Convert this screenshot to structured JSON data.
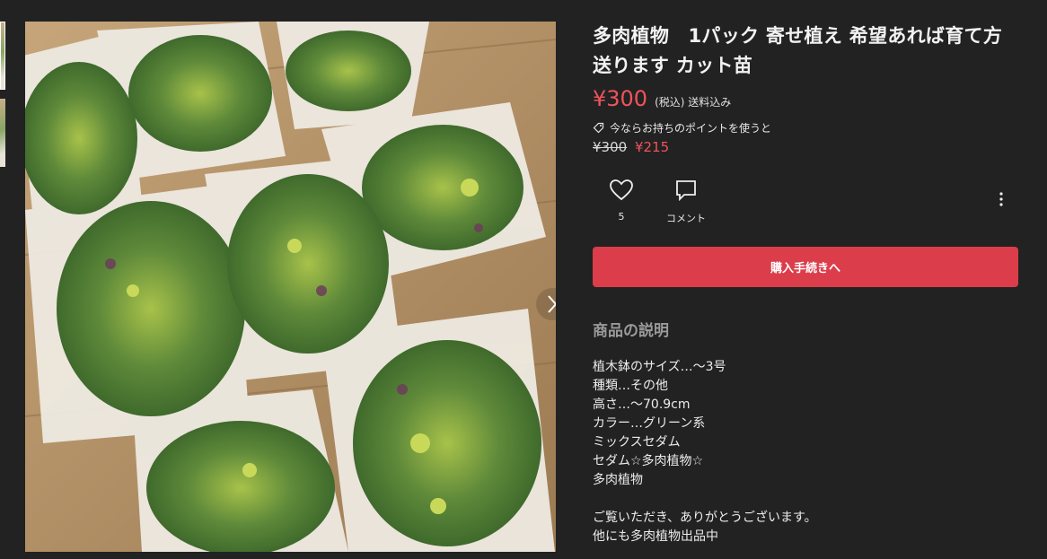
{
  "listing": {
    "title": "多肉植物　1パック 寄せ植え 希望あれば育て方送ります カット苗",
    "price": "¥300",
    "tax_note": "(税込) 送料込み",
    "points_note": "今ならお持ちのポイントを使うと",
    "old_price": "¥300",
    "discount_price": "¥215",
    "like_count": "5",
    "comment_label": "コメント",
    "buy_label": "購入手続きへ"
  },
  "description": {
    "heading": "商品の説明",
    "lines": [
      "植木鉢のサイズ…～3号",
      "種類…その他",
      "高さ…～70.9cm",
      "カラー…グリーン系",
      "ミックスセダム",
      "セダム☆多肉植物☆",
      "多肉植物"
    ],
    "closing": [
      "ご覧いただき、ありがとうございます。",
      "他にも多肉植物出品中"
    ]
  },
  "icons": {
    "like": "heart-icon",
    "comment": "speech-bubble-icon",
    "more": "more-vertical-icon",
    "points": "tag-icon",
    "next": "chevron-right-icon"
  },
  "colors": {
    "background": "#222222",
    "price": "#f0535b",
    "button": "#db3d4b"
  }
}
